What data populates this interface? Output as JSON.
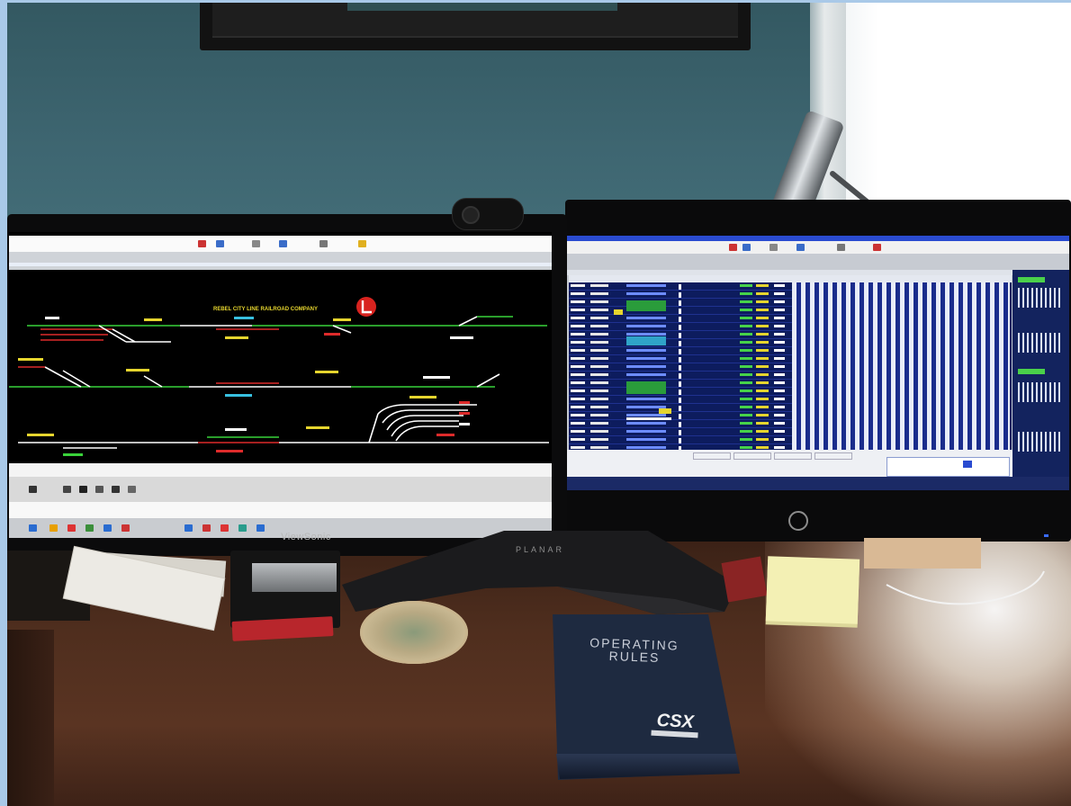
{
  "left_monitor": {
    "brand": "ViewSonic",
    "screen_title": "REBEL CITY LINE RAILROAD COMPANY"
  },
  "monitor_stand": {
    "brand": "PLANAR"
  },
  "binder": {
    "title_line_1": "OPERATING",
    "title_line_2": "RULES",
    "logo_text": "CSX"
  },
  "colors": {
    "wall": "#3e6671",
    "desk": "#4a2a1a",
    "binder": "#1e2a40",
    "track_green": "#39d23a",
    "track_red": "#de2b2b",
    "signal_yellow": "#e6d52e",
    "screen_navy": "#0d1c5e",
    "sticky_note": "#f3f0b4"
  },
  "icons": [
    "railroad-logo-icon",
    "desk-lamp-icon",
    "webcam-icon"
  ]
}
